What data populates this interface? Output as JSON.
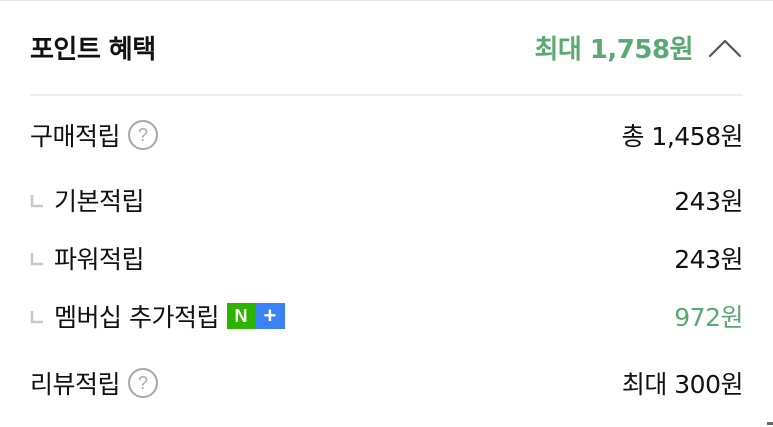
{
  "header": {
    "title": "포인트 혜택",
    "max_label": "최대 1,758원",
    "toggle_icon": "chevron-up-icon"
  },
  "colors": {
    "accent_green": "#5aa873",
    "divider": "#ededed",
    "naver_green": "#2db400",
    "plus_blue": "#3b82f6"
  },
  "purchase": {
    "label": "구매적립",
    "help_icon": "?",
    "value": "총 1,458원"
  },
  "sub_items": [
    {
      "label": "기본적립",
      "value": "243원"
    },
    {
      "label": "파워적립",
      "value": "243원"
    },
    {
      "label": "멤버십 추가적립",
      "value": "972원",
      "badge_n": "N",
      "badge_plus": "+"
    }
  ],
  "review": {
    "label": "리뷰적립",
    "help_icon": "?",
    "value": "최대 300원"
  }
}
